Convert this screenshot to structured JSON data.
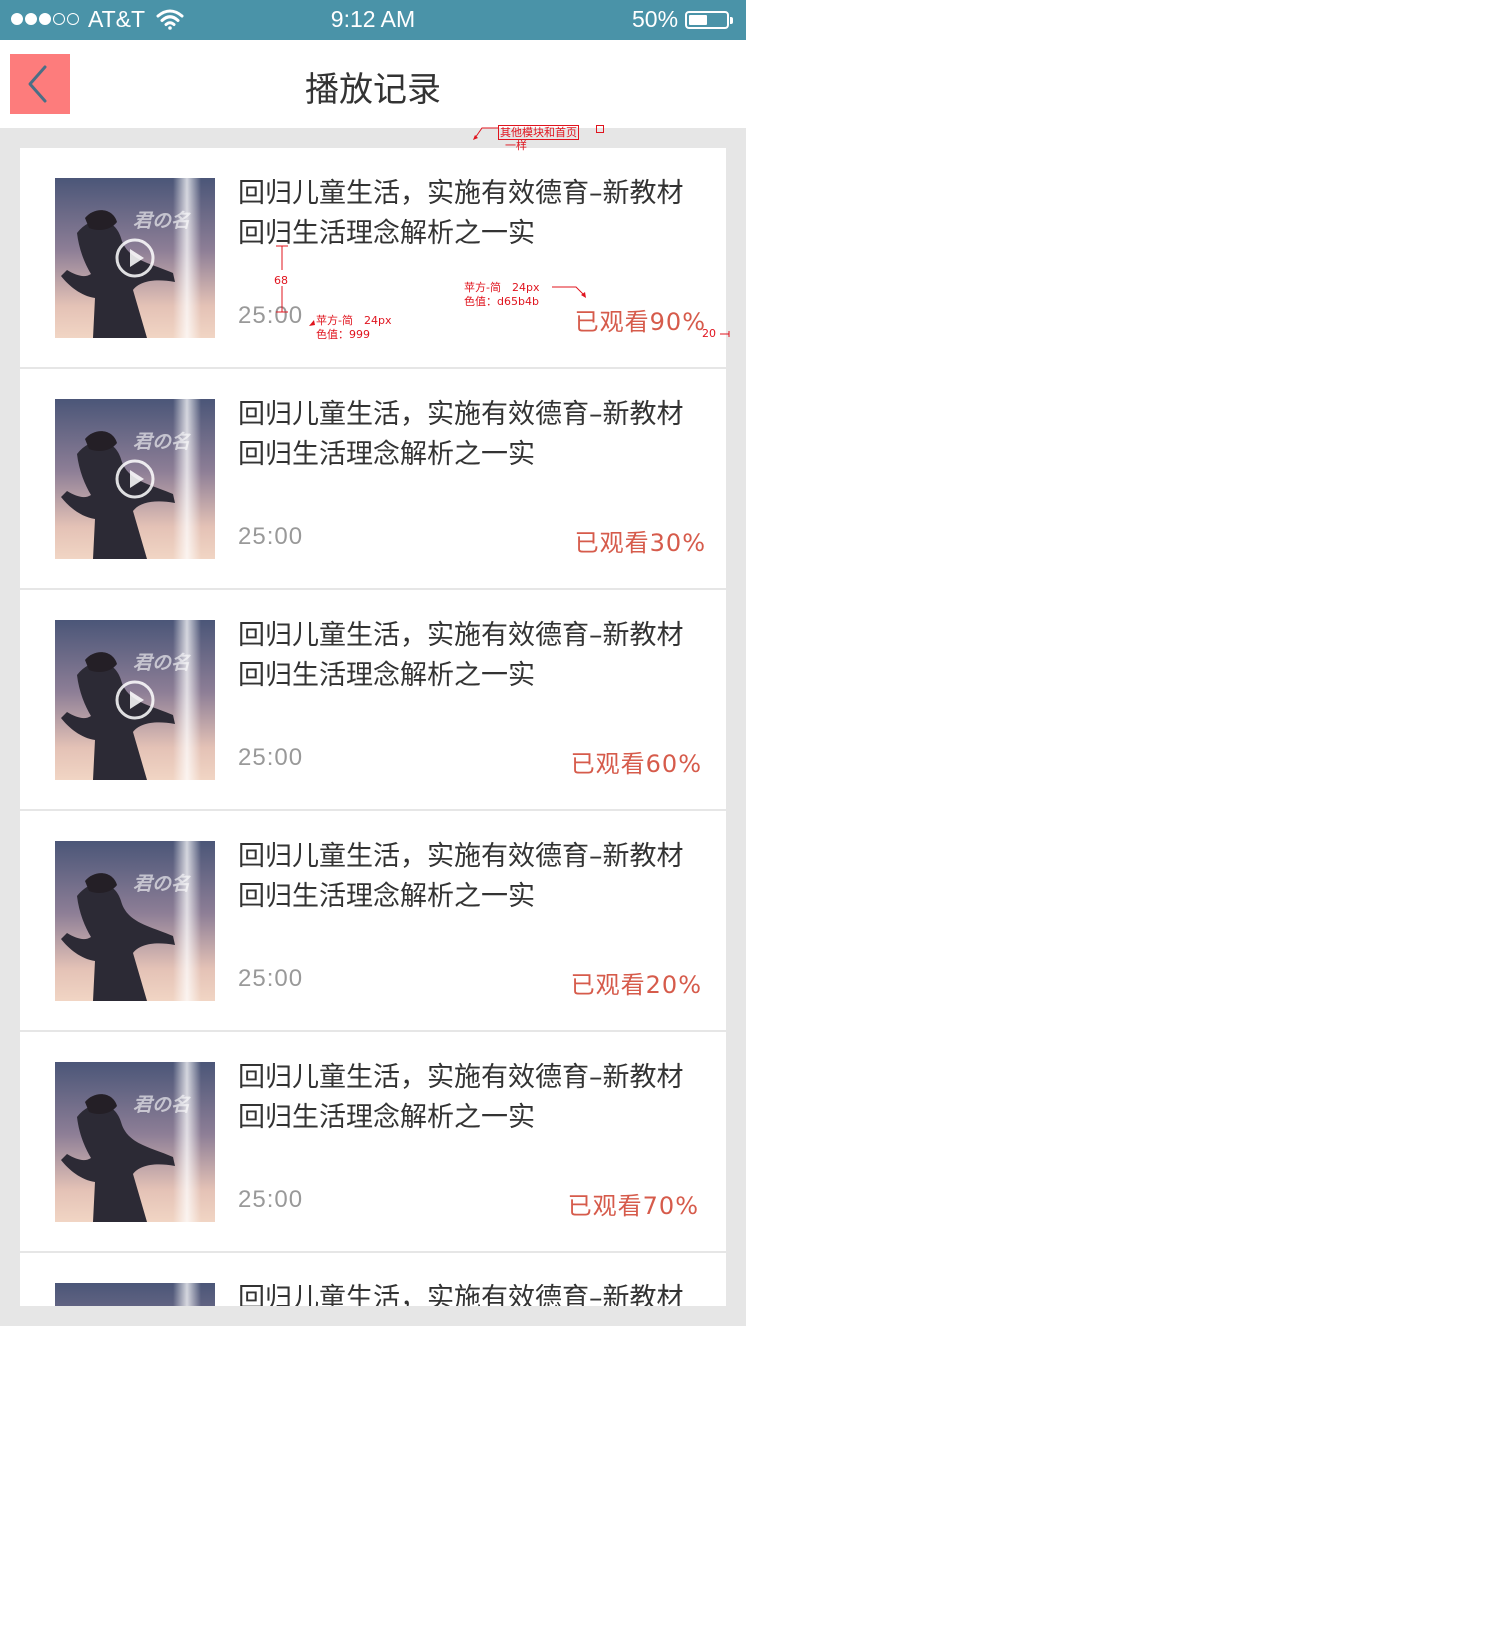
{
  "status_bar": {
    "carrier": "AT&T",
    "time": "9:12 AM",
    "battery": "50%",
    "battery_level": 0.5,
    "signal_bars": 3,
    "signal_total": 5
  },
  "nav": {
    "title": "播放记录",
    "back_icon": "chevron-left-icon"
  },
  "colors": {
    "status_bar": "#4a93a8",
    "back_button": "#fd7c7c",
    "duration": "#999999",
    "progress": "#d65b4b",
    "background": "#e6e6e6"
  },
  "items": [
    {
      "title": "回归儿童生活，实施有效德育–新教材回归生活理念解析之一实",
      "duration": "25:00",
      "progress": "已观看90%",
      "play_icon": true
    },
    {
      "title": "回归儿童生活，实施有效德育–新教材回归生活理念解析之一实",
      "duration": "25:00",
      "progress": "已观看30%",
      "play_icon": true
    },
    {
      "title": "回归儿童生活，实施有效德育–新教材回归生活理念解析之一实",
      "duration": "25:00",
      "progress": "已观看60%",
      "play_icon": true
    },
    {
      "title": "回归儿童生活，实施有效德育–新教材回归生活理念解析之一实",
      "duration": "25:00",
      "progress": "已观看20%",
      "play_icon": false
    },
    {
      "title": "回归儿童生活，实施有效德育–新教材回归生活理念解析之一实",
      "duration": "25:00",
      "progress": "已观看70%",
      "play_icon": false
    },
    {
      "title": "回归儿童生活，实施有效德育–新教材回归生活理念解析之一实",
      "duration": "",
      "progress": "",
      "play_icon": false
    }
  ],
  "thumbnail_text": "君の名",
  "annotations": {
    "module_note_line1": "其他模块和首页",
    "module_note_line2": "一样",
    "spacing_68": "68",
    "font_title_line1": "苹方-简　24px",
    "font_title_line2": "色值：d65b4b",
    "font_duration_line1": "苹方-简　24px",
    "font_duration_line2": "色值：999",
    "margin_20": "20"
  }
}
